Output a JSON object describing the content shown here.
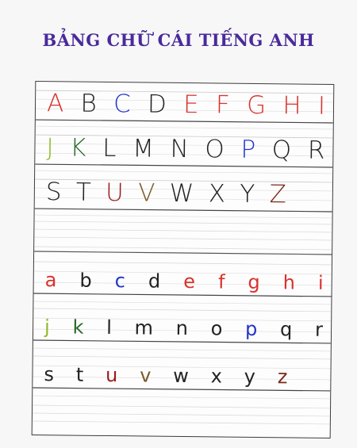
{
  "title": "BẢNG CHỮ CÁI TIẾNG ANH",
  "colors": {
    "title": "#4a2a9a",
    "red": "#d8322c",
    "blue": "#2235c8",
    "green": "#8fba2a",
    "dark_green": "#2a6a2a",
    "purple": "#6a3aa8",
    "dark_red": "#9a1a1a",
    "brown": "#7a5a2a",
    "maroon": "#7a2a1a",
    "black": "#222222"
  },
  "uppercase": [
    [
      {
        "ch": "A",
        "color": "#d8322c"
      },
      {
        "ch": "B",
        "color": "#222222"
      },
      {
        "ch": "C",
        "color": "#2235c8"
      },
      {
        "ch": "D",
        "color": "#222222"
      },
      {
        "ch": "E",
        "color": "#d8322c"
      },
      {
        "ch": "F",
        "color": "#d8322c"
      },
      {
        "ch": "G",
        "color": "#d8322c"
      },
      {
        "ch": "H",
        "color": "#d8322c"
      },
      {
        "ch": "I",
        "color": "#d8322c"
      }
    ],
    [
      {
        "ch": "J",
        "color": "#8fba2a"
      },
      {
        "ch": "K",
        "color": "#2a6a2a"
      },
      {
        "ch": "L",
        "color": "#222222"
      },
      {
        "ch": "M",
        "color": "#222222"
      },
      {
        "ch": "N",
        "color": "#222222"
      },
      {
        "ch": "O",
        "color": "#222222"
      },
      {
        "ch": "P",
        "color": "#2235c8"
      },
      {
        "ch": "Q",
        "color": "#222222"
      },
      {
        "ch": "R",
        "color": "#222222"
      }
    ],
    [
      {
        "ch": "S",
        "color": "#222222"
      },
      {
        "ch": "T",
        "color": "#222222"
      },
      {
        "ch": "U",
        "color": "#9a1a1a"
      },
      {
        "ch": "V",
        "color": "#7a5a2a"
      },
      {
        "ch": "W",
        "color": "#222222"
      },
      {
        "ch": "X",
        "color": "#222222"
      },
      {
        "ch": "Y",
        "color": "#222222"
      },
      {
        "ch": "Z",
        "color": "#7a2a1a"
      }
    ]
  ],
  "lowercase": [
    [
      {
        "ch": "a",
        "color": "#d8322c"
      },
      {
        "ch": "b",
        "color": "#222222"
      },
      {
        "ch": "c",
        "color": "#2235c8"
      },
      {
        "ch": "d",
        "color": "#222222"
      },
      {
        "ch": "e",
        "color": "#d8322c"
      },
      {
        "ch": "f",
        "color": "#d8322c"
      },
      {
        "ch": "g",
        "color": "#d8322c"
      },
      {
        "ch": "h",
        "color": "#d8322c"
      },
      {
        "ch": "i",
        "color": "#d8322c"
      }
    ],
    [
      {
        "ch": "j",
        "color": "#8fba2a"
      },
      {
        "ch": "k",
        "color": "#2a6a2a"
      },
      {
        "ch": "l",
        "color": "#222222"
      },
      {
        "ch": "m",
        "color": "#222222"
      },
      {
        "ch": "n",
        "color": "#222222"
      },
      {
        "ch": "o",
        "color": "#222222"
      },
      {
        "ch": "p",
        "color": "#2235c8"
      },
      {
        "ch": "q",
        "color": "#222222"
      },
      {
        "ch": "r",
        "color": "#222222"
      }
    ],
    [
      {
        "ch": "s",
        "color": "#222222"
      },
      {
        "ch": "t",
        "color": "#222222"
      },
      {
        "ch": "u",
        "color": "#9a1a1a"
      },
      {
        "ch": "v",
        "color": "#7a5a2a"
      },
      {
        "ch": "w",
        "color": "#222222"
      },
      {
        "ch": "x",
        "color": "#222222"
      },
      {
        "ch": "y",
        "color": "#222222"
      },
      {
        "ch": "z",
        "color": "#7a2a1a"
      }
    ]
  ]
}
